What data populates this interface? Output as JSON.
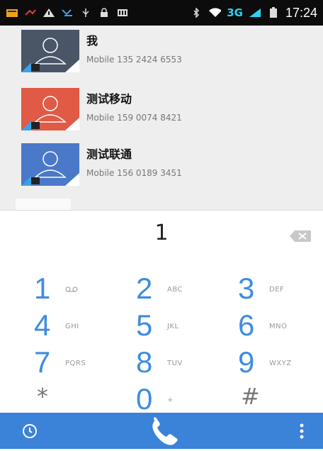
{
  "status_bar": {
    "network": "3G",
    "time": "17:24"
  },
  "contacts": [
    {
      "name": "我",
      "phone": "Mobile 135 2424 6553",
      "avatar_color": "#4a5568"
    },
    {
      "name": "测试移动",
      "phone": "Mobile 159 0074 8421",
      "avatar_color": "#e05a45"
    },
    {
      "name": "测试联通",
      "phone": "Mobile 156 0189 3451",
      "avatar_color": "#4a79c9"
    }
  ],
  "dialer": {
    "entered_number": "1",
    "keys": [
      {
        "digit": "1",
        "letters": ""
      },
      {
        "digit": "2",
        "letters": "ABC"
      },
      {
        "digit": "3",
        "letters": "DEF"
      },
      {
        "digit": "4",
        "letters": "GHI"
      },
      {
        "digit": "5",
        "letters": "JKL"
      },
      {
        "digit": "6",
        "letters": "MNO"
      },
      {
        "digit": "7",
        "letters": "PQRS"
      },
      {
        "digit": "8",
        "letters": "TUV"
      },
      {
        "digit": "9",
        "letters": "WXYZ"
      },
      {
        "digit": "*",
        "letters": ""
      },
      {
        "digit": "0",
        "letters": "+"
      },
      {
        "digit": "#",
        "letters": ""
      }
    ]
  },
  "colors": {
    "accent": "#3b82d9",
    "digit": "#3d8de0"
  }
}
